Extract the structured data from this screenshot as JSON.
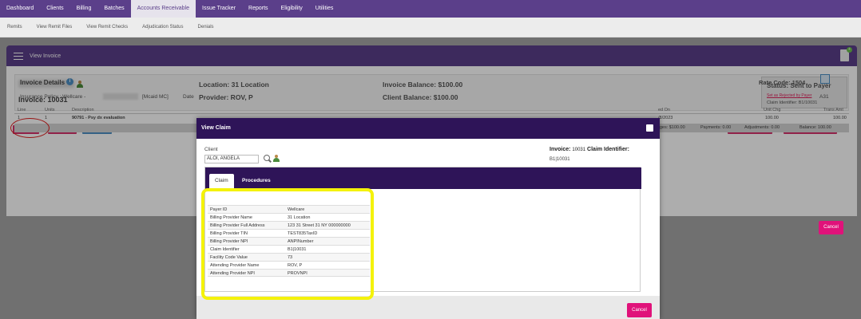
{
  "nav": {
    "items": [
      {
        "label": "Dashboard",
        "active": false
      },
      {
        "label": "Clients",
        "active": false
      },
      {
        "label": "Billing",
        "active": false
      },
      {
        "label": "Batches",
        "active": false
      },
      {
        "label": "Accounts Receivable",
        "active": true
      },
      {
        "label": "Issue Tracker",
        "active": false
      },
      {
        "label": "Reports",
        "active": false
      },
      {
        "label": "Eligibility",
        "active": false
      },
      {
        "label": "Utilities",
        "active": false
      }
    ]
  },
  "subnav": {
    "items": [
      "Remits",
      "View Remit Files",
      "View Remit Checks",
      "Adjudication Status",
      "Denials"
    ]
  },
  "bar": {
    "title": "View Invoice"
  },
  "invoice": {
    "number": "Invoice: 10031",
    "location": "Location: 31 Location",
    "provider": "Provider: ROV, P",
    "invoice_balance": "Invoice Balance: $100.00",
    "client_balance": "Client Balance: $100.00",
    "status": "Status: Sent to Payer",
    "status_link": "Set as Rejected by Payer",
    "claim_identifier": "Claim Identifier: B1/10031"
  },
  "buttons": {
    "view_claim": "View Claim",
    "view_details": "View Details",
    "admin_tasks": "Admin Tasks",
    "add_issue": "Add to Issue Tracker",
    "post_manual": "Post Manual Transaction",
    "cancel": "Cancel"
  },
  "details": {
    "title": "Invoice Details",
    "policy_prefix": "Insurance Policy : Wellcare -",
    "policy_suffix": "[Mcaid MC]",
    "date_label": "Date",
    "rate_code": "Rate Code: 1504",
    "code": "A31",
    "columns": {
      "line": "Line",
      "units": "Units",
      "description": "Description",
      "filed_on": "ed On",
      "unit_chg": "Unit Chg",
      "trans_amt": "Trans Amt"
    },
    "row": {
      "line": "1",
      "units": "1",
      "description": "90791 - Psy dx evaluation",
      "filed_on": "/8/2023",
      "unit_chg": "100.00",
      "trans_amt": "100.00"
    },
    "totals": {
      "charges": "rges: $100.00",
      "payments": "Payments: 0.00",
      "adjustments": "Adjustments: 0.00",
      "balance": "Balance: 100.00"
    }
  },
  "modal": {
    "title": "View Claim",
    "client_label": "Client",
    "client_value": "ALOI, ANGELA",
    "invoice_label": "Invoice:",
    "invoice_number": "10031",
    "claim_id_label": "Claim Identifier:",
    "claim_id_value": "B1|10031",
    "tabs": [
      {
        "label": "Claim",
        "active": true
      },
      {
        "label": "Procedures",
        "active": false
      }
    ],
    "rows": [
      {
        "key": "Payer ID",
        "value": "Wellcare"
      },
      {
        "key": "Billing Provider Name",
        "value": "31 Location"
      },
      {
        "key": "Billing Provider Full Address",
        "value": "123 31 Street 31 NY 000000000"
      },
      {
        "key": "Billing Provider TIN",
        "value": "TEST835TaxID"
      },
      {
        "key": "Billing Provider NPI",
        "value": "ANPINumber"
      },
      {
        "key": "Claim Identifier",
        "value": "B1|10031"
      },
      {
        "key": "Facility Code Value",
        "value": "73"
      },
      {
        "key": "Attending Provider Name",
        "value": "ROV, P"
      },
      {
        "key": "Attending Provider NPI",
        "value": "PROVNPI"
      }
    ],
    "cancel": "Cancel"
  },
  "colors": {
    "nav": "#5b3f8a",
    "modal_header": "#2e1458",
    "accent_pink": "#e0127a",
    "highlight": "#f4f20a",
    "circle": "#e02020"
  }
}
